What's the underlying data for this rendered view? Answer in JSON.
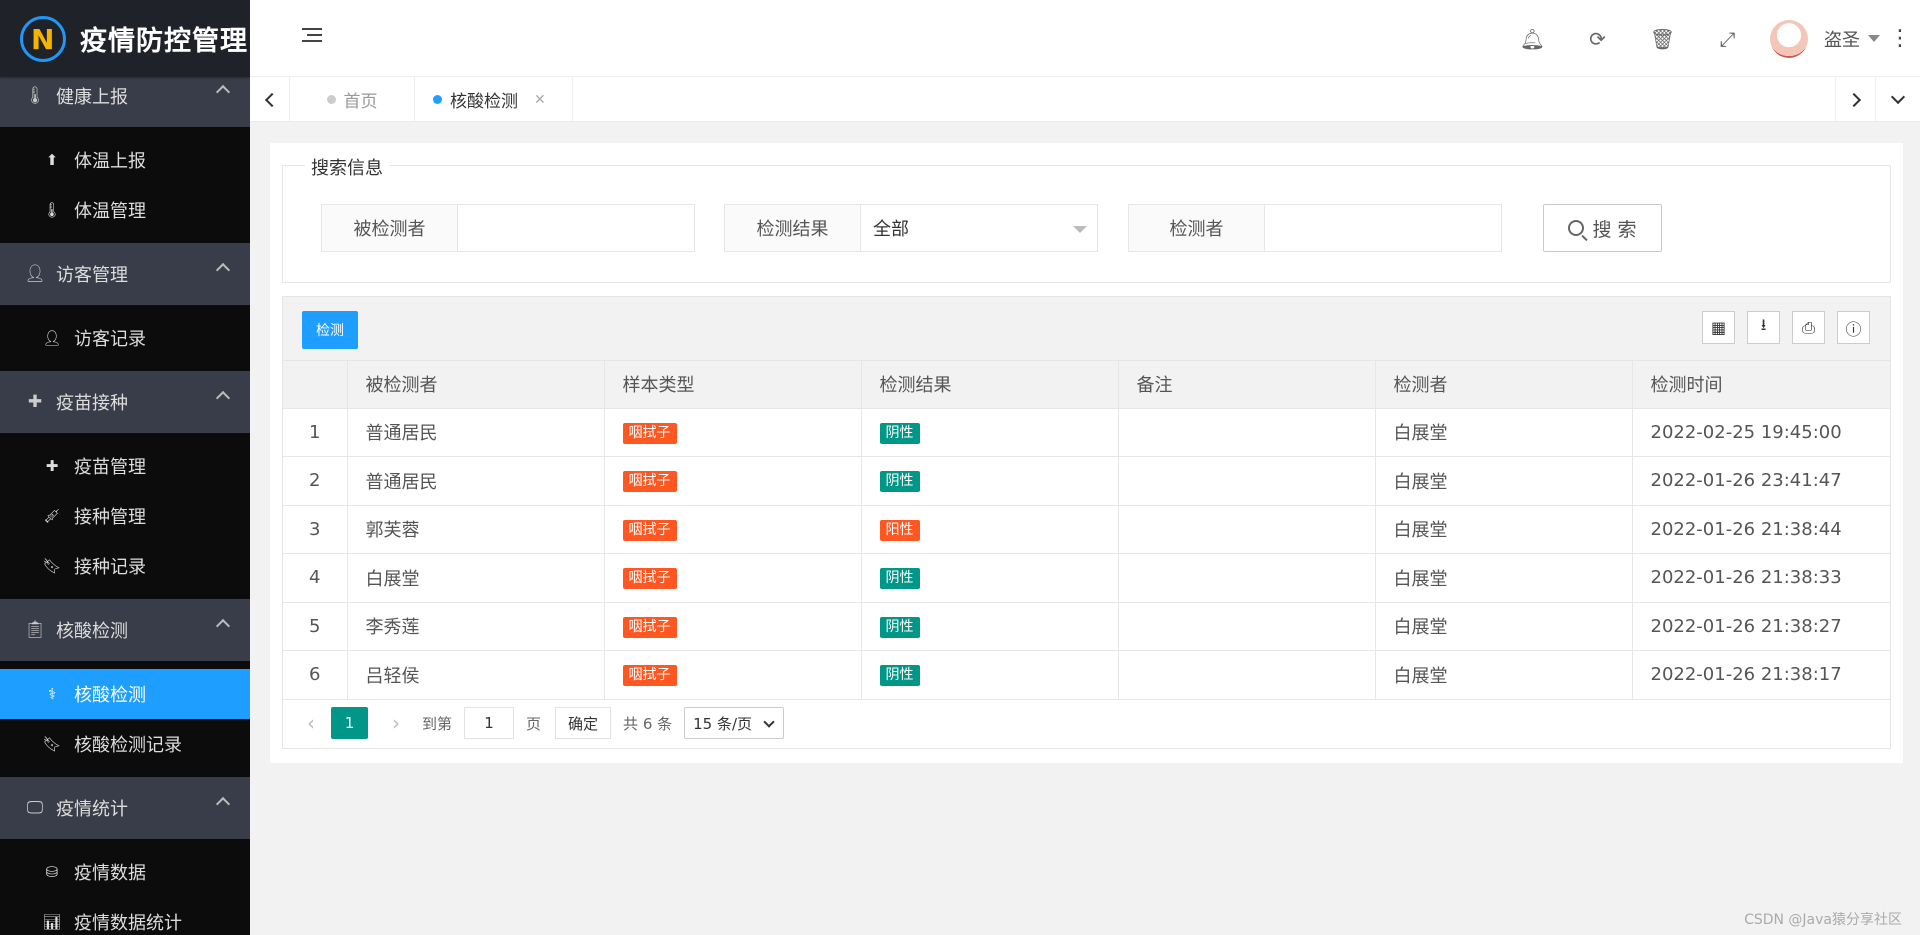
{
  "app": {
    "title": "疫情防控管理"
  },
  "sidebar": {
    "groups": [
      {
        "label": "健康上报",
        "icon": "thermometer-icon",
        "items": [
          {
            "label": "体温上报",
            "icon": "upload-circle-icon"
          },
          {
            "label": "体温管理",
            "icon": "thermometer-icon"
          }
        ]
      },
      {
        "label": "访客管理",
        "icon": "user-add-icon",
        "items": [
          {
            "label": "访客记录",
            "icon": "visitor-icon"
          }
        ]
      },
      {
        "label": "疫苗接种",
        "icon": "medkit-icon",
        "items": [
          {
            "label": "疫苗管理",
            "icon": "medkit-icon"
          },
          {
            "label": "接种管理",
            "icon": "syringe-icon"
          },
          {
            "label": "接种记录",
            "icon": "bookmark-icon"
          }
        ]
      },
      {
        "label": "核酸检测",
        "icon": "clipboard-icon",
        "items": [
          {
            "label": "核酸检测",
            "icon": "stethoscope-icon",
            "active": true
          },
          {
            "label": "核酸检测记录",
            "icon": "bookmark-outline-icon"
          }
        ]
      },
      {
        "label": "疫情统计",
        "icon": "monitor-icon",
        "items": [
          {
            "label": "疫情数据",
            "icon": "database-icon"
          },
          {
            "label": "疫情数据统计",
            "icon": "bar-chart-icon"
          }
        ]
      }
    ]
  },
  "header": {
    "username": "盗圣"
  },
  "tabs": {
    "home": "首页",
    "current": "核酸检测"
  },
  "search": {
    "legend": "搜索信息",
    "fields": {
      "testee_label": "被检测者",
      "testee_value": "",
      "result_label": "检测结果",
      "result_value": "全部",
      "tester_label": "检测者",
      "tester_value": ""
    },
    "button": "搜 索"
  },
  "toolbar": {
    "check_button": "检测"
  },
  "table": {
    "columns": [
      "",
      "被检测者",
      "样本类型",
      "检测结果",
      "备注",
      "检测者",
      "检测时间"
    ],
    "rows": [
      {
        "no": "1",
        "testee": "普通居民",
        "sample": "咽拭子",
        "result": "阴性",
        "result_color": "#009688",
        "note": "",
        "tester": "白展堂",
        "time": "2022-02-25 19:45:00"
      },
      {
        "no": "2",
        "testee": "普通居民",
        "sample": "咽拭子",
        "result": "阴性",
        "result_color": "#009688",
        "note": "",
        "tester": "白展堂",
        "time": "2022-01-26 23:41:47"
      },
      {
        "no": "3",
        "testee": "郭芙蓉",
        "sample": "咽拭子",
        "result": "阳性",
        "result_color": "#ff5722",
        "note": "",
        "tester": "白展堂",
        "time": "2022-01-26 21:38:44"
      },
      {
        "no": "4",
        "testee": "白展堂",
        "sample": "咽拭子",
        "result": "阴性",
        "result_color": "#009688",
        "note": "",
        "tester": "白展堂",
        "time": "2022-01-26 21:38:33"
      },
      {
        "no": "5",
        "testee": "李秀莲",
        "sample": "咽拭子",
        "result": "阴性",
        "result_color": "#009688",
        "note": "",
        "tester": "白展堂",
        "time": "2022-01-26 21:38:27"
      },
      {
        "no": "6",
        "testee": "吕轻侯",
        "sample": "咽拭子",
        "result": "阴性",
        "result_color": "#009688",
        "note": "",
        "tester": "白展堂",
        "time": "2022-01-26 21:38:17"
      }
    ]
  },
  "pagination": {
    "current_page": "1",
    "goto_label": "到第",
    "goto_value": "1",
    "page_label": "页",
    "confirm": "确定",
    "total": "共 6 条",
    "page_size": "15 条/页"
  },
  "watermark": "CSDN @Java猿分享社区",
  "colors": {
    "accent": "#1e9fff",
    "sidebar": "#20222a",
    "positive": "#ff5722",
    "negative": "#009688"
  }
}
